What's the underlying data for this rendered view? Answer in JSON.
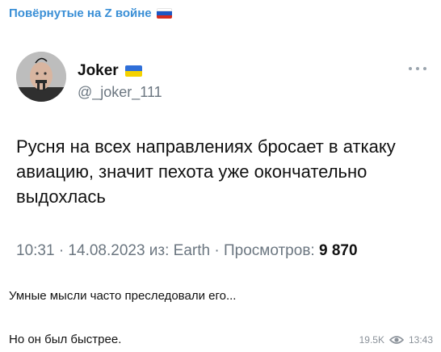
{
  "channel": {
    "title": "Повёрнутые на Z войне"
  },
  "tweet": {
    "author_name": "Joker",
    "author_handle": "@_joker_111",
    "text": "Русня на всех направлениях бросает в аткаку авиацию, значит пехота уже окончательно выдохлась",
    "meta_prefix": "10:31 · 14.08.2023 из: Earth · Просмотров: ",
    "views": "9 870"
  },
  "post": {
    "caption_line1": "Умные мысли часто преследовали его...",
    "caption_line2": "Но он был быстрее.",
    "views": "19.5K",
    "time": "13:43"
  },
  "colors": {
    "channel_title": "#3a8fd6",
    "meta_gray": "#6b7680",
    "flag_ru": [
      "#ffffff",
      "#1c57c4",
      "#d52b1e"
    ],
    "flag_ua": [
      "#2f6fd8",
      "#f4d200"
    ]
  },
  "icons": {
    "flag_ru": "flag-ru-icon",
    "flag_ua": "flag-ua-icon",
    "more": "more-dots-icon",
    "views": "eye-icon"
  }
}
